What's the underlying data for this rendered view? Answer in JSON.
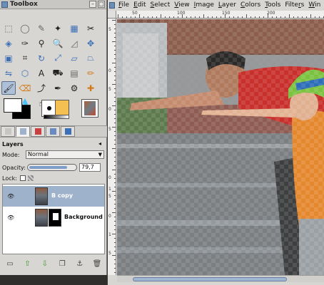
{
  "toolbox": {
    "title": "Toolbox",
    "tools": [
      {
        "name": "rect-select-icon",
        "glyph": "⬚",
        "cls": "t-gray"
      },
      {
        "name": "ellipse-select-icon",
        "glyph": "◯",
        "cls": "t-gray"
      },
      {
        "name": "free-select-icon",
        "glyph": "✎",
        "cls": "t-gray"
      },
      {
        "name": "fuzzy-select-icon",
        "glyph": "✦",
        "cls": "t-dark"
      },
      {
        "name": "color-select-icon",
        "glyph": "▦",
        "cls": "t-blue"
      },
      {
        "name": "scissors-icon",
        "glyph": "✂",
        "cls": "t-dark"
      },
      {
        "name": "foreground-select-icon",
        "glyph": "◈",
        "cls": "t-blue"
      },
      {
        "name": "paths-icon",
        "glyph": "✑",
        "cls": "t-dark"
      },
      {
        "name": "color-picker-icon",
        "glyph": "⚲",
        "cls": "t-dark"
      },
      {
        "name": "zoom-icon",
        "glyph": "🔍",
        "cls": "t-gray"
      },
      {
        "name": "measure-icon",
        "glyph": "◿",
        "cls": "t-gray"
      },
      {
        "name": "move-icon",
        "glyph": "✥",
        "cls": "t-blue"
      },
      {
        "name": "align-icon",
        "glyph": "▣",
        "cls": "t-blue"
      },
      {
        "name": "crop-icon",
        "glyph": "⌗",
        "cls": "t-dark"
      },
      {
        "name": "rotate-icon",
        "glyph": "↻",
        "cls": "t-blue"
      },
      {
        "name": "scale-icon",
        "glyph": "⤢",
        "cls": "t-blue"
      },
      {
        "name": "shear-icon",
        "glyph": "▱",
        "cls": "t-blue"
      },
      {
        "name": "perspective-icon",
        "glyph": "⏢",
        "cls": "t-blue"
      },
      {
        "name": "flip-icon",
        "glyph": "⇋",
        "cls": "t-blue"
      },
      {
        "name": "cage-icon",
        "glyph": "⬡",
        "cls": "t-blue"
      },
      {
        "name": "text-icon",
        "glyph": "A",
        "cls": "t-dark"
      },
      {
        "name": "bucket-fill-icon",
        "glyph": "⛟",
        "cls": "t-dark"
      },
      {
        "name": "blend-icon",
        "glyph": "▤",
        "cls": "t-gray"
      },
      {
        "name": "pencil-icon",
        "glyph": "✏",
        "cls": "t-orange"
      },
      {
        "name": "paintbrush-icon",
        "glyph": "🖌",
        "cls": "t-dark"
      },
      {
        "name": "eraser-icon",
        "glyph": "⌫",
        "cls": "t-orange"
      },
      {
        "name": "airbrush-icon",
        "glyph": "⤴",
        "cls": "t-dark"
      },
      {
        "name": "ink-icon",
        "glyph": "✒",
        "cls": "t-dark"
      },
      {
        "name": "clone-icon",
        "glyph": "⚙",
        "cls": "t-dark"
      },
      {
        "name": "heal-icon",
        "glyph": "✚",
        "cls": "t-orange"
      },
      {
        "name": "perspective-clone-icon",
        "glyph": "◪",
        "cls": "t-dark"
      },
      {
        "name": "blur-icon",
        "glyph": "💧",
        "cls": "t-blue"
      },
      {
        "name": "smudge-icon",
        "glyph": "☝",
        "cls": "t-dark"
      },
      {
        "name": "dodge-burn-icon",
        "glyph": "●",
        "cls": "t-dark"
      }
    ],
    "active_tool_index": 24,
    "dock_tabs": [
      "tool-options",
      "layers",
      "channels",
      "paths",
      "undo-history"
    ]
  },
  "layers": {
    "title": "Layers",
    "mode_label": "Mode:",
    "mode_value": "Normal",
    "opacity_label": "Opacity:",
    "opacity_value": "79,7",
    "opacity_fraction": 0.797,
    "lock_label": "Lock:",
    "items": [
      {
        "name": "B copy",
        "selected": true,
        "has_mask": false
      },
      {
        "name": "Background",
        "selected": false,
        "has_mask": true
      }
    ]
  },
  "image_window": {
    "menu": [
      "File",
      "Edit",
      "Select",
      "View",
      "Image",
      "Layer",
      "Colors",
      "Tools",
      "Filters",
      "Win"
    ],
    "menu_underline": [
      "F",
      "E",
      "S",
      "V",
      "I",
      "L",
      "C",
      "T",
      "r",
      "W"
    ],
    "ruler_top": [
      "50",
      "100",
      "150",
      "200"
    ],
    "ruler_left": [
      "5",
      "0",
      "5",
      "0",
      "5",
      "0",
      "1",
      "5",
      "0",
      "1",
      "5"
    ]
  },
  "colors": {
    "accent": "#9fb2cc",
    "highlight": "#aebfd8",
    "chrome": "#d8d6d2"
  }
}
